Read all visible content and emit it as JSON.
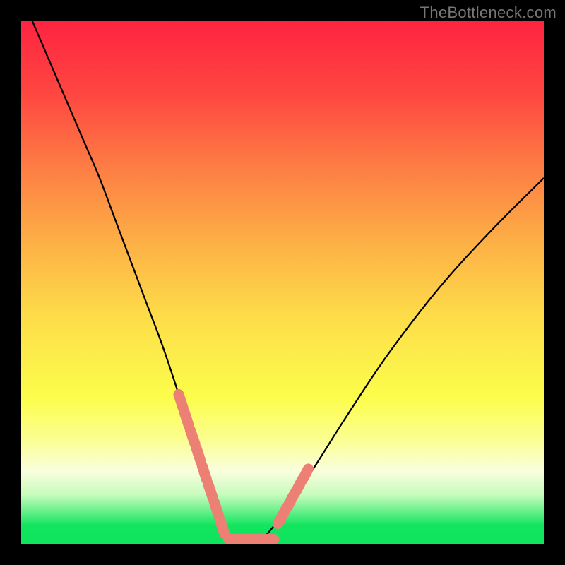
{
  "watermark": "TheBottleneck.com",
  "chart_data": {
    "type": "line",
    "title": "",
    "xlabel": "",
    "ylabel": "",
    "xlim": [
      0,
      100
    ],
    "ylim": [
      0,
      100
    ],
    "series": [
      {
        "name": "bottleneck-curve",
        "x": [
          0,
          3,
          6,
          9,
          12,
          15,
          18,
          21,
          24,
          27,
          30,
          33,
          35.5,
          38,
          41.5,
          45,
          48,
          55,
          62,
          70,
          80,
          90,
          100
        ],
        "values": [
          105,
          98,
          91,
          84,
          77,
          70,
          62,
          54,
          46,
          38,
          29,
          19,
          10,
          3,
          0.5,
          0.5,
          3,
          13,
          24,
          36,
          49,
          60,
          70
        ],
        "color": "#000000"
      },
      {
        "name": "highlight-segments",
        "type": "scatter",
        "color": "#ec8074",
        "segments": [
          {
            "x": [
              30.0,
              31.1,
              32.2,
              33.4,
              34.5,
              35.6,
              36.8,
              37.9,
              39.0
            ],
            "values": [
              29.0,
              25.6,
              22.2,
              18.7,
              15.3,
              11.9,
              8.4,
              5.0,
              1.6
            ]
          },
          {
            "x": [
              39.5,
              40.6,
              41.8,
              42.9,
              44.0,
              45.1,
              46.3,
              47.4,
              48.5
            ],
            "values": [
              0.9,
              0.9,
              0.9,
              0.9,
              0.9,
              0.9,
              0.9,
              0.9,
              0.9
            ]
          },
          {
            "x": [
              49.0,
              49.8,
              50.5,
              51.3,
              52.0,
              52.8,
              53.5,
              54.3,
              55.0
            ],
            "values": [
              3.7,
              5.1,
              6.4,
              7.7,
              9.1,
              10.4,
              11.8,
              13.1,
              14.5
            ]
          }
        ]
      }
    ],
    "background_gradient": [
      {
        "stop": 0.0,
        "color": "#fe2441"
      },
      {
        "stop": 0.14,
        "color": "#fe4741"
      },
      {
        "stop": 0.29,
        "color": "#fd8144"
      },
      {
        "stop": 0.43,
        "color": "#fdb246"
      },
      {
        "stop": 0.57,
        "color": "#fdde49"
      },
      {
        "stop": 0.72,
        "color": "#fcfd4b"
      },
      {
        "stop": 0.8,
        "color": "#fbfe90"
      },
      {
        "stop": 0.86,
        "color": "#fafedd"
      },
      {
        "stop": 0.905,
        "color": "#c9fcbe"
      },
      {
        "stop": 0.935,
        "color": "#70f18f"
      },
      {
        "stop": 0.965,
        "color": "#11e55e"
      },
      {
        "stop": 1.0,
        "color": "#0fe45d"
      }
    ]
  }
}
